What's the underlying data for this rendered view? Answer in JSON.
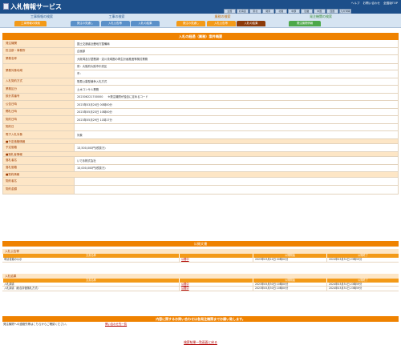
{
  "header": {
    "title": "入札情報サービス",
    "toplinks": [
      "ヘルプ",
      "お問い合わせ",
      "全国版TOP"
    ],
    "regions": [
      "全国",
      "北海道",
      "東北",
      "関東",
      "北陸",
      "中部",
      "近畿",
      "中国",
      "四国",
      "九州沖縄"
    ]
  },
  "sections": [
    {
      "heading": "工事情報の検索",
      "tabs": [
        "工事情報の検索",
        "入札・契約結果"
      ]
    },
    {
      "heading": "工事の検索",
      "tabs": [
        "発注の見通し",
        "入札公告等",
        "入札の結果"
      ]
    },
    {
      "heading": "業務の検索",
      "tabs": [
        "発注の見通し",
        "入札公告等",
        "入札の結果"
      ]
    },
    {
      "heading": "発注機関の検索",
      "tabs": [
        "発注機関情報"
      ]
    }
  ],
  "detail": {
    "title": "入札の経過（業務）案件概要",
    "rows": [
      {
        "label": "発注機関",
        "value": "国土交通省近畿地方整備局"
      },
      {
        "label": "担当部・事務所",
        "value": "企画部"
      },
      {
        "label": "業務名称",
        "value": "大阪湾及び琵琶湖・淀川流域圏の再生計画推進等検討業務"
      },
      {
        "label": "業務対象地域",
        "value": "府：大阪府大阪市中央区",
        "value2": "市："
      },
      {
        "label": "入札契約方式",
        "value": "簡易公募型競争入札方式"
      },
      {
        "label": "業務区分",
        "value": "土木コンサル業務"
      },
      {
        "label": "設計書番号",
        "value": "202306221700000",
        "value_note": "※発注機関が独自に定めるコード"
      },
      {
        "label": "公告日時",
        "value": "2023年03月24日 00時00分"
      },
      {
        "label": "開札日時",
        "value": "2023年05月23日 10時00分"
      },
      {
        "label": "契約日時",
        "value": "2023年05月29日 11時17分"
      },
      {
        "label": "契約日",
        "value": ""
      },
      {
        "label": "電子入札対象",
        "value": "対象"
      }
    ],
    "price_section": "■予定価格情報",
    "price_rows": [
      {
        "label": "予定価格",
        "value": "13,500,000円(税抜き)"
      }
    ],
    "winner_section": "■落札者情報",
    "winner_rows": [
      {
        "label": "落札者名",
        "value": "いであ株式会社"
      },
      {
        "label": "落札価格",
        "value": "10,000,000円(税抜き)"
      }
    ],
    "contract_section": "■契約情報",
    "contract_rows": [
      {
        "label": "契約者名",
        "value": ""
      },
      {
        "label": "契約金額",
        "value": ""
      }
    ]
  },
  "public_docs": {
    "title": "公開文書",
    "groups": [
      {
        "name": "入札公告等",
        "columns": [
          "文書名称",
          "",
          "公開開始",
          "公開終了"
        ],
        "rows": [
          {
            "name": "申請書類の公示",
            "link": "公開中",
            "start": "2023年03月24日 00時00分",
            "end": "2024年03月31日 23時59分"
          }
        ]
      },
      {
        "name": "入札結果",
        "columns": [
          "文書名称",
          "",
          "公開開始",
          "公開終了"
        ],
        "rows": [
          {
            "name": "入札調書",
            "link": "公開中",
            "start": "2023年05月30日 10時00分",
            "end": "2024年03月31日 23時59分"
          },
          {
            "name": "入札調書（総合評価落札方式）",
            "link": "公開中",
            "start": "2023年05月30日 10時00分",
            "end": "2024年03月31日 23時59分"
          }
        ]
      }
    ]
  },
  "contact": {
    "heading": "内容に関するお問い合わせは各発注機関までお願い致します。",
    "text": "発注機関への連絡先等はこちらからご確認ください。",
    "link": "問い合わせ先一覧"
  },
  "back_link": "検索結果一覧画面に戻る",
  "colors": {
    "header": "#1d4f8a",
    "accent": "#ef8200",
    "label_bg": "#fde6c6",
    "link": "#b10000"
  }
}
